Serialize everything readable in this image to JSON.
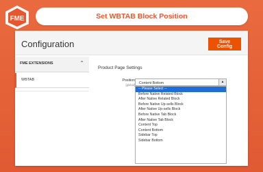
{
  "banner": {
    "title": "Set WBTAB Block Position",
    "logo_text": "FME"
  },
  "header": {
    "title": "Configuration",
    "save_label": "Save Config"
  },
  "sidebar": {
    "section": "FME EXTENSIONS",
    "items": [
      {
        "label": "WBTAB"
      }
    ]
  },
  "main": {
    "section_title": "Product Page Settings",
    "field": {
      "label": "Position",
      "scope": "[global]",
      "value": "Content Bottom",
      "options": [
        "-- Please Select --",
        "Before Native Related Block",
        "After Native Related Block",
        "Before Native Up-sells Block",
        "After Native Up-sells Block",
        "Before Native Tab Block",
        "After Native Tab Block",
        "Content Top",
        "Content Bottom",
        "Sidebar Top",
        "Sidebar Bottom"
      ],
      "highlighted_option": "-- Please Select --"
    }
  },
  "colors": {
    "accent": "#e6572f",
    "button": "#eb5202",
    "highlight": "#1e6ed8"
  }
}
